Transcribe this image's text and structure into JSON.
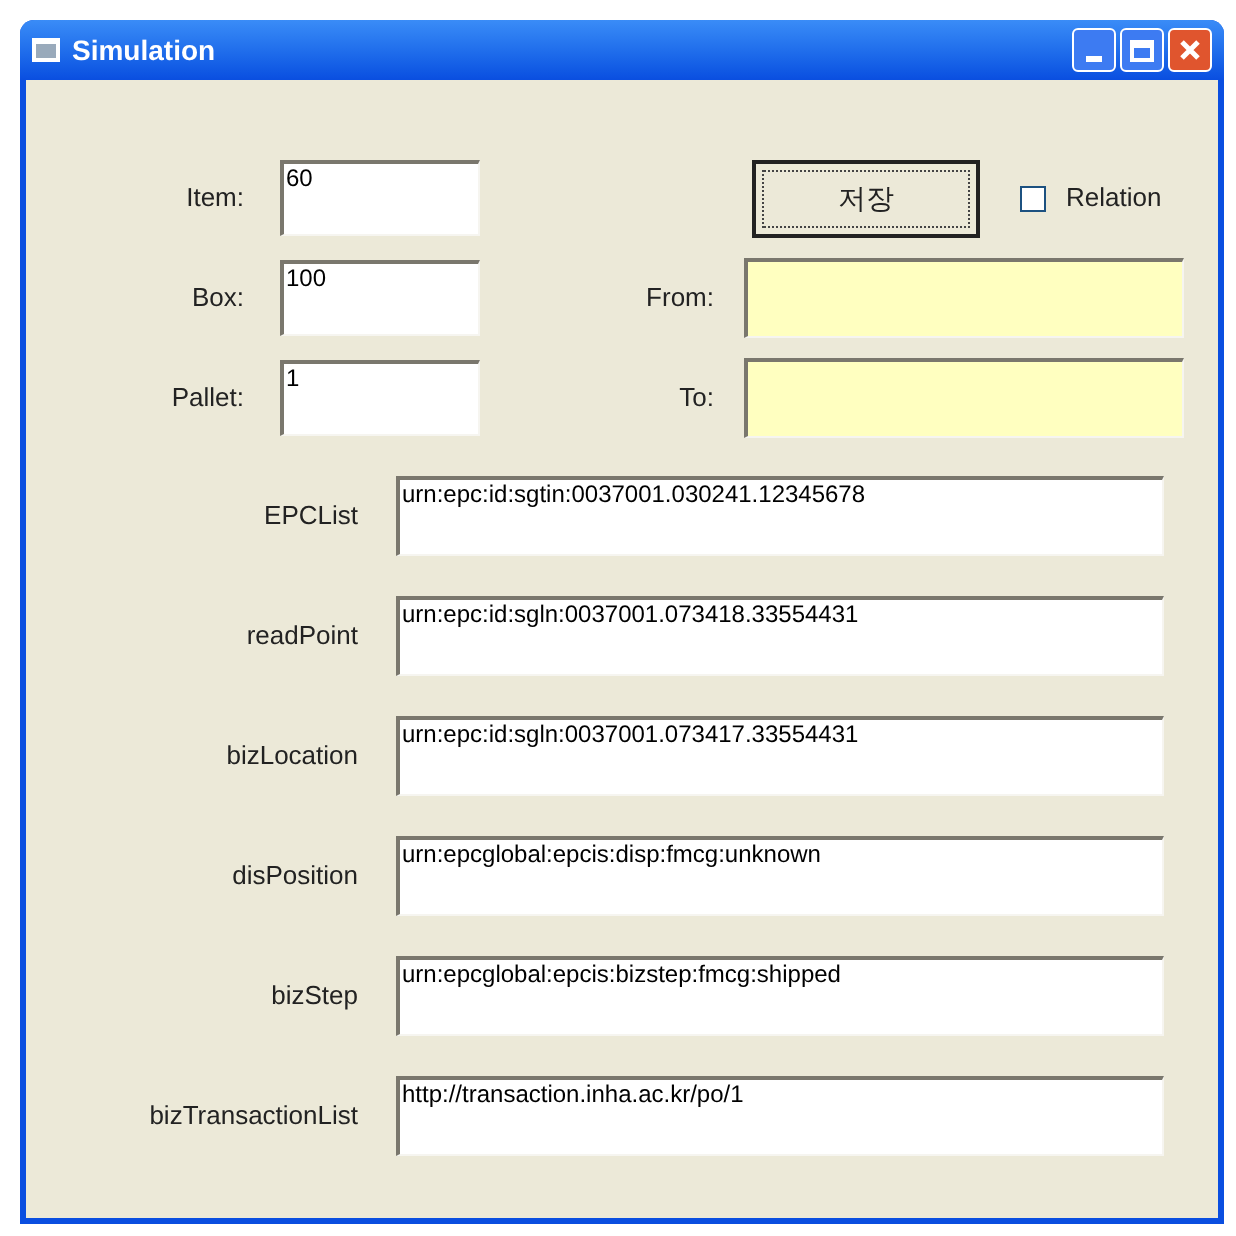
{
  "window": {
    "title": "Simulation"
  },
  "quantities": [
    {
      "label": "Item:",
      "value": "60"
    },
    {
      "label": "Box:",
      "value": "100"
    },
    {
      "label": "Pallet:",
      "value": "1"
    }
  ],
  "save_button": {
    "label": "저장"
  },
  "relation": {
    "label": "Relation",
    "checked": false
  },
  "locations": [
    {
      "label": "From:"
    },
    {
      "label": "To:"
    }
  ],
  "event_fields": [
    {
      "label": "EPCList",
      "value": "urn:epc:id:sgtin:0037001.030241.12345678"
    },
    {
      "label": "readPoint",
      "value": "urn:epc:id:sgln:0037001.073418.33554431"
    },
    {
      "label": "bizLocation",
      "value": "urn:epc:id:sgln:0037001.073417.33554431"
    },
    {
      "label": "disPosition",
      "value": "urn:epcglobal:epcis:disp:fmcg:unknown"
    },
    {
      "label": "bizStep",
      "value": "urn:epcglobal:epcis:bizstep:fmcg:shipped"
    },
    {
      "label": "bizTransactionList",
      "value": "http://transaction.inha.ac.kr/po/1"
    }
  ]
}
